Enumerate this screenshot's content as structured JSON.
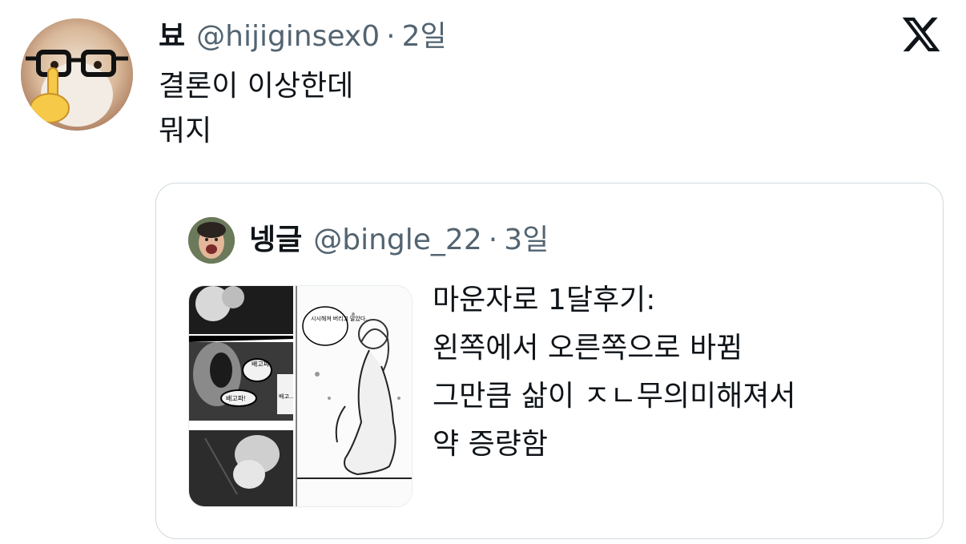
{
  "tweet": {
    "author_name": "뵤",
    "author_handle": "@hijiginsex0",
    "separator": "·",
    "time": "2일",
    "lines": [
      "결론이 이상한데",
      "뭐지"
    ],
    "logo_icon": "x-logo-icon"
  },
  "quoted_tweet": {
    "author_name": "넹글",
    "author_handle": "@bingle_22",
    "separator": "·",
    "time": "3일",
    "lines": [
      "마운자로 1달후기:",
      "왼쪽에서 오른쪽으로 바뀜",
      "그만큼 삶이 ㅈㄴ무의미해져서",
      "약 증량함"
    ],
    "thumbnail": {
      "panel_texts": [
        "배고파.",
        "배고파!",
        "배고...",
        "시시해져 버리고 말았다."
      ]
    }
  },
  "colors": {
    "text_primary": "#0f1419",
    "text_secondary": "#536471",
    "border": "#cfd9de"
  }
}
